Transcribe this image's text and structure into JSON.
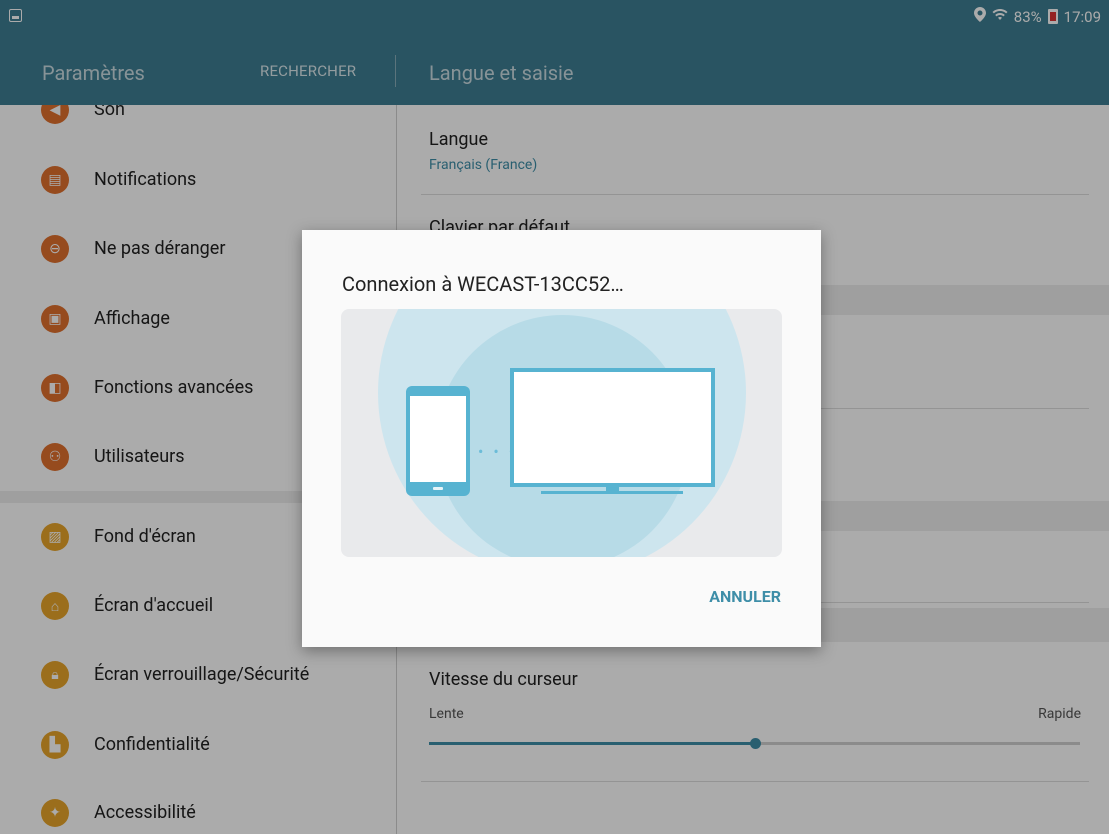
{
  "status": {
    "battery": "83%",
    "time": "17:09"
  },
  "app": {
    "title": "Paramètres",
    "search": "RECHERCHER",
    "page_title": "Langue et saisie"
  },
  "sidebar": {
    "items": [
      {
        "label": "Son",
        "icon": "speaker-icon",
        "color": "#e0702e"
      },
      {
        "label": "Notifications",
        "icon": "notification-icon",
        "color": "#e0702e"
      },
      {
        "label": "Ne pas déranger",
        "icon": "do-not-disturb-icon",
        "color": "#e0702e"
      },
      {
        "label": "Affichage",
        "icon": "display-icon",
        "color": "#e0702e"
      },
      {
        "label": "Fonctions avancées",
        "icon": "advanced-features-icon",
        "color": "#e0702e"
      },
      {
        "label": "Utilisateurs",
        "icon": "users-icon",
        "color": "#e0702e"
      },
      {
        "label": "Fond d'écran",
        "icon": "wallpaper-icon",
        "color": "#e8a52a"
      },
      {
        "label": "Écran d'accueil",
        "icon": "home-icon",
        "color": "#e8a52a"
      },
      {
        "label": "Écran verrouillage/Sécurité",
        "icon": "lock-icon",
        "color": "#e8a52a"
      },
      {
        "label": "Confidentialité",
        "icon": "privacy-icon",
        "color": "#e8a52a"
      },
      {
        "label": "Accessibilité",
        "icon": "accessibility-icon",
        "color": "#e8a52a"
      }
    ]
  },
  "main": {
    "language_title": "Langue",
    "language_value": "Français (France)",
    "keyboard_title": "Clavier par défaut",
    "cursor_speed_title": "Vitesse du curseur",
    "slow_label": "Lente",
    "fast_label": "Rapide",
    "cursor_speed_fraction": 0.5
  },
  "dialog": {
    "title": "Connexion à WECAST-13CC52…",
    "cancel": "ANNULER"
  },
  "colors": {
    "accent": "#3e8ea8",
    "bar": "#3e7e92"
  }
}
